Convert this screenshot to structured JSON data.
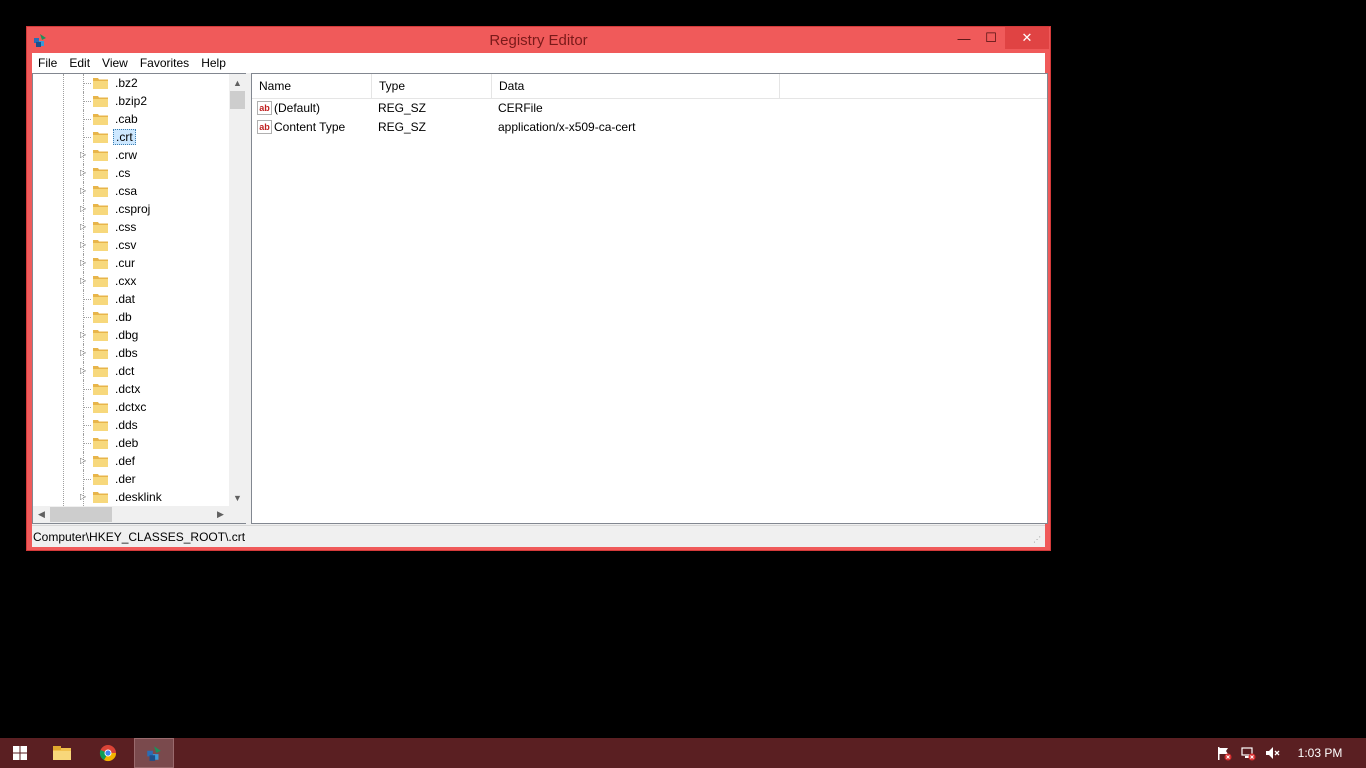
{
  "window": {
    "title": "Registry Editor",
    "accent_color": "#f05a5a",
    "buttons": {
      "minimize": "—",
      "maximize": "☐",
      "close": "✕"
    }
  },
  "menu": [
    "File",
    "Edit",
    "View",
    "Favorites",
    "Help"
  ],
  "tree": {
    "items": [
      {
        "label": ".bz2",
        "expandable": false
      },
      {
        "label": ".bzip2",
        "expandable": false
      },
      {
        "label": ".cab",
        "expandable": false
      },
      {
        "label": ".crt",
        "expandable": false,
        "selected": true
      },
      {
        "label": ".crw",
        "expandable": true
      },
      {
        "label": ".cs",
        "expandable": true
      },
      {
        "label": ".csa",
        "expandable": true
      },
      {
        "label": ".csproj",
        "expandable": true
      },
      {
        "label": ".css",
        "expandable": true
      },
      {
        "label": ".csv",
        "expandable": true
      },
      {
        "label": ".cur",
        "expandable": true
      },
      {
        "label": ".cxx",
        "expandable": true
      },
      {
        "label": ".dat",
        "expandable": false
      },
      {
        "label": ".db",
        "expandable": false
      },
      {
        "label": ".dbg",
        "expandable": true
      },
      {
        "label": ".dbs",
        "expandable": true
      },
      {
        "label": ".dct",
        "expandable": true
      },
      {
        "label": ".dctx",
        "expandable": false
      },
      {
        "label": ".dctxc",
        "expandable": false
      },
      {
        "label": ".dds",
        "expandable": false
      },
      {
        "label": ".deb",
        "expandable": false
      },
      {
        "label": ".def",
        "expandable": true
      },
      {
        "label": ".der",
        "expandable": false
      },
      {
        "label": ".desklink",
        "expandable": true
      }
    ]
  },
  "list": {
    "columns": [
      "Name",
      "Type",
      "Data"
    ],
    "rows": [
      {
        "name": "(Default)",
        "type": "REG_SZ",
        "data": "CERFile"
      },
      {
        "name": "Content Type",
        "type": "REG_SZ",
        "data": "application/x-x509-ca-cert"
      }
    ],
    "value_icon": "ab"
  },
  "status": {
    "path": "Computer\\HKEY_CLASSES_ROOT\\.crt"
  },
  "taskbar": {
    "color": "#5a1f22",
    "clock": "1:03 PM",
    "icons": [
      "windows-start-icon",
      "file-explorer-icon",
      "chrome-icon",
      "registry-editor-icon"
    ],
    "tray": [
      "action-center-flag-icon",
      "network-icon",
      "volume-muted-icon"
    ]
  }
}
